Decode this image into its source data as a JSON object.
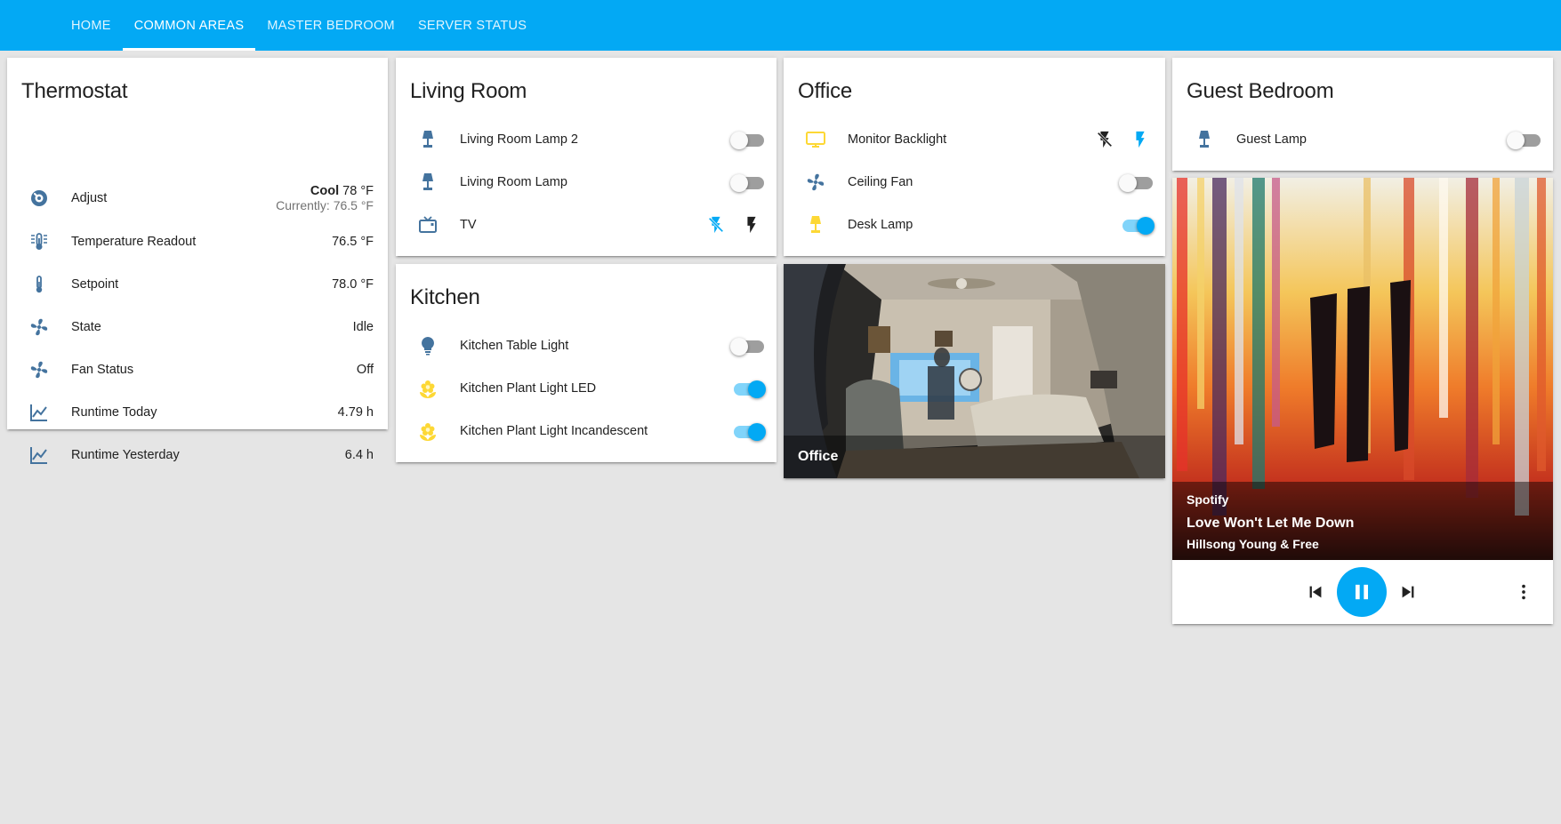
{
  "tabs": [
    {
      "label": "HOME"
    },
    {
      "label": "COMMON AREAS"
    },
    {
      "label": "MASTER BEDROOM"
    },
    {
      "label": "SERVER STATUS"
    }
  ],
  "active_tab": "COMMON AREAS",
  "thermostat": {
    "title": "Thermostat",
    "adjust": {
      "label": "Adjust",
      "mode": "Cool",
      "target": "78 °F",
      "current": "Currently: 76.5 °F",
      "icon": "thermostat-dial-icon"
    },
    "rows": [
      {
        "label": "Temperature Readout",
        "value": "76.5 °F",
        "icon": "temperature-readout-icon"
      },
      {
        "label": "Setpoint",
        "value": "78.0 °F",
        "icon": "thermometer-icon"
      },
      {
        "label": "State",
        "value": "Idle",
        "icon": "fan-icon"
      },
      {
        "label": "Fan Status",
        "value": "Off",
        "icon": "fan-icon"
      },
      {
        "label": "Runtime Today",
        "value": "4.79 h",
        "icon": "chart-line-icon"
      },
      {
        "label": "Runtime Yesterday",
        "value": "6.4 h",
        "icon": "chart-line-icon"
      }
    ]
  },
  "living_room": {
    "title": "Living Room",
    "items": [
      {
        "label": "Living Room Lamp 2",
        "state": "off",
        "icon": "lamp-icon"
      },
      {
        "label": "Living Room Lamp",
        "state": "off",
        "icon": "lamp-icon"
      },
      {
        "label": "TV",
        "control": "power-buttons",
        "icon": "tv-icon"
      }
    ]
  },
  "kitchen": {
    "title": "Kitchen",
    "items": [
      {
        "label": "Kitchen Table Light",
        "state": "off",
        "icon": "lightbulb-icon"
      },
      {
        "label": "Kitchen Plant Light LED",
        "state": "on",
        "icon": "flower-icon"
      },
      {
        "label": "Kitchen Plant Light Incandescent",
        "state": "on",
        "icon": "flower-icon"
      }
    ]
  },
  "office": {
    "title": "Office",
    "items": [
      {
        "label": "Monitor Backlight",
        "control": "power-buttons",
        "icon": "monitor-icon"
      },
      {
        "label": "Ceiling Fan",
        "state": "off",
        "icon": "fan-icon"
      },
      {
        "label": "Desk Lamp",
        "state": "on",
        "icon": "lamp-icon"
      }
    ],
    "camera_label": "Office"
  },
  "guest_bedroom": {
    "title": "Guest Bedroom",
    "items": [
      {
        "label": "Guest Lamp",
        "state": "off",
        "icon": "lamp-icon"
      }
    ]
  },
  "media": {
    "source": "Spotify",
    "track": "Love Won't Let Me Down",
    "artist": "Hillsong Young & Free",
    "state": "playing"
  },
  "colors": {
    "header": "#03a9f4",
    "accent": "#03a9f4",
    "icon_off": "#44739e",
    "icon_on": "#fdd835",
    "background": "#e5e5e5"
  }
}
